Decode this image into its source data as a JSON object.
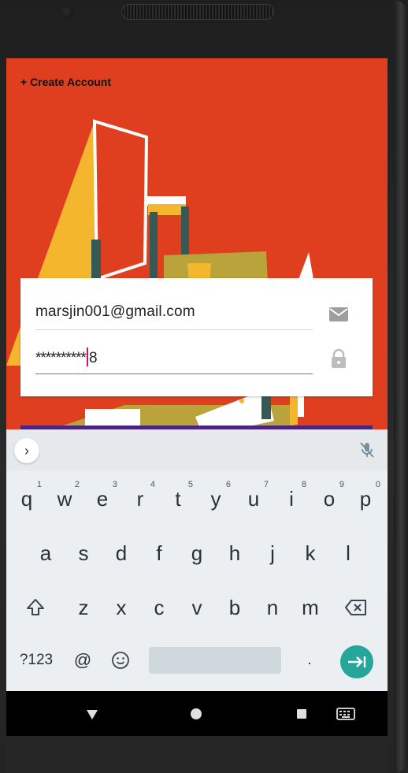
{
  "header": {
    "create_account_label": "+ Create Account"
  },
  "login": {
    "email_value": "marsjin001@gmail.com",
    "password_mask": "**********",
    "password_last_char": "8"
  },
  "keyboard": {
    "row1": [
      {
        "key": "q",
        "hint": "1"
      },
      {
        "key": "w",
        "hint": "2"
      },
      {
        "key": "e",
        "hint": "3"
      },
      {
        "key": "r",
        "hint": "4"
      },
      {
        "key": "t",
        "hint": "5"
      },
      {
        "key": "y",
        "hint": "6"
      },
      {
        "key": "u",
        "hint": "7"
      },
      {
        "key": "i",
        "hint": "8"
      },
      {
        "key": "o",
        "hint": "9"
      },
      {
        "key": "p",
        "hint": "0"
      }
    ],
    "row2": [
      "a",
      "s",
      "d",
      "f",
      "g",
      "h",
      "j",
      "k",
      "l"
    ],
    "row3": [
      "z",
      "x",
      "c",
      "v",
      "b",
      "n",
      "m"
    ],
    "symbols_label": "?123",
    "at_label": "@",
    "period_label": "."
  },
  "colors": {
    "background_accent": "#e03f1f",
    "art_yellow": "#f4b62c",
    "art_olive": "#b9a33a",
    "art_teal": "#355a56",
    "strip_purple": "#4a2580",
    "enter_teal": "#26a69a",
    "cursor_pink": "#c2185b"
  },
  "icons": {
    "expand": "chevron-right-icon",
    "mic": "mic-off-icon",
    "email": "mail-icon",
    "password": "lock-icon",
    "shift": "shift-icon",
    "backspace": "backspace-icon",
    "emoji": "emoji-icon",
    "enter": "enter-arrow-icon",
    "back": "nav-back-icon",
    "home": "nav-home-icon",
    "recents": "nav-recents-icon",
    "keyboard": "keyboard-icon"
  }
}
